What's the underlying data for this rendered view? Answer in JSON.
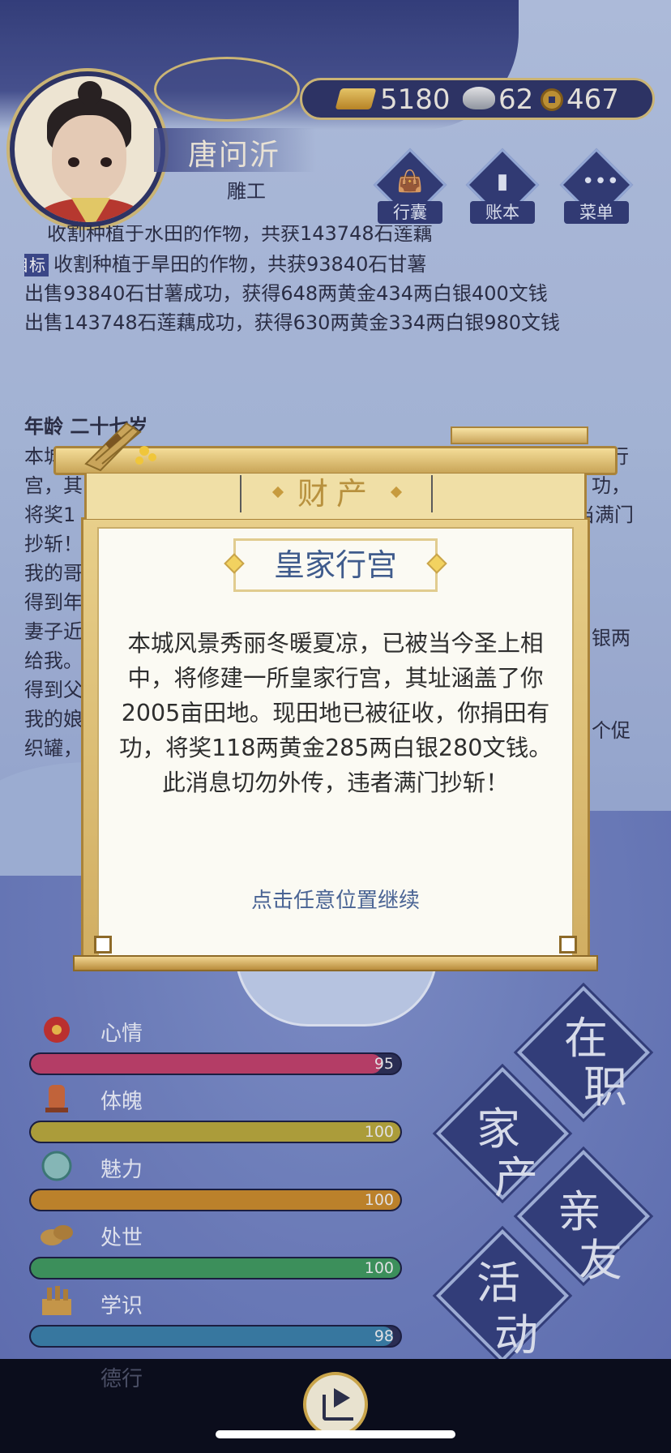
{
  "player": {
    "name": "唐问沂",
    "title": "雕工"
  },
  "currency": {
    "gold": "5180",
    "silver": "62",
    "coin": "467"
  },
  "top_buttons": [
    {
      "label": "行囊",
      "icon": "bag-icon"
    },
    {
      "label": "账本",
      "icon": "ledger-icon"
    },
    {
      "label": "菜单",
      "icon": "menu-dots-icon"
    }
  ],
  "log": {
    "line0": "收割种植于水田的作物，共获143748石莲藕",
    "target_tag": "目标",
    "line1": "收割种植于旱田的作物，共获93840石甘薯",
    "line2": "出售93840石甘薯成功，获得648两黄金434两白银400文钱",
    "line3": "出售143748石莲藕成功，获得630两黄金334两白银980文钱",
    "age": "年龄 二十七岁",
    "bg_lines": [
      "本城风",
      "宫，其",
      "将奖1",
      "抄斩！",
      "我的哥",
      "得到年",
      "妻子近",
      "给我。",
      "得到父",
      "我的娘",
      "织罐，"
    ],
    "bg_right": [
      "行",
      "功，",
      "当满门",
      "银两",
      "个促"
    ]
  },
  "modal": {
    "header": "财产",
    "subtitle": "皇家行宫",
    "body": "本城风景秀丽冬暖夏凉，已被当今圣上相中，将修建一所皇家行宫，其址涵盖了你2005亩田地。现田地已被征收，你捐田有功，将奖118两黄金285两白银280文钱。此消息切勿外传，违者满门抄斩！",
    "continue": "点击任意位置继续"
  },
  "stats": [
    {
      "label": "心情",
      "value": "95",
      "fraction": 0.95,
      "color": "#c2416a",
      "icon": "flower-icon"
    },
    {
      "label": "体魄",
      "value": "100",
      "fraction": 1.0,
      "color": "#b8a83a",
      "icon": "bell-icon"
    },
    {
      "label": "魅力",
      "value": "100",
      "fraction": 1.0,
      "color": "#c98a2a",
      "icon": "jade-icon"
    },
    {
      "label": "处世",
      "value": "100",
      "fraction": 1.0,
      "color": "#3f9a5e",
      "icon": "hands-icon"
    },
    {
      "label": "学识",
      "value": "98",
      "fraction": 0.98,
      "color": "#3a7fa8",
      "icon": "books-icon"
    },
    {
      "label": "德行",
      "value": "",
      "fraction": 1.0,
      "color": "#5a2f6a",
      "icon": "lotus-icon"
    }
  ],
  "big_buttons": [
    {
      "c1": "在",
      "c2": "职"
    },
    {
      "c1": "家",
      "c2": "产"
    },
    {
      "c1": "亲",
      "c2": "友"
    },
    {
      "c1": "活",
      "c2": "动"
    }
  ],
  "colors": {
    "frame_gold": "#d1ae62",
    "navy": "#35407e",
    "paper": "#fbfaf3",
    "subtitle_blue": "#3f5b8c"
  }
}
